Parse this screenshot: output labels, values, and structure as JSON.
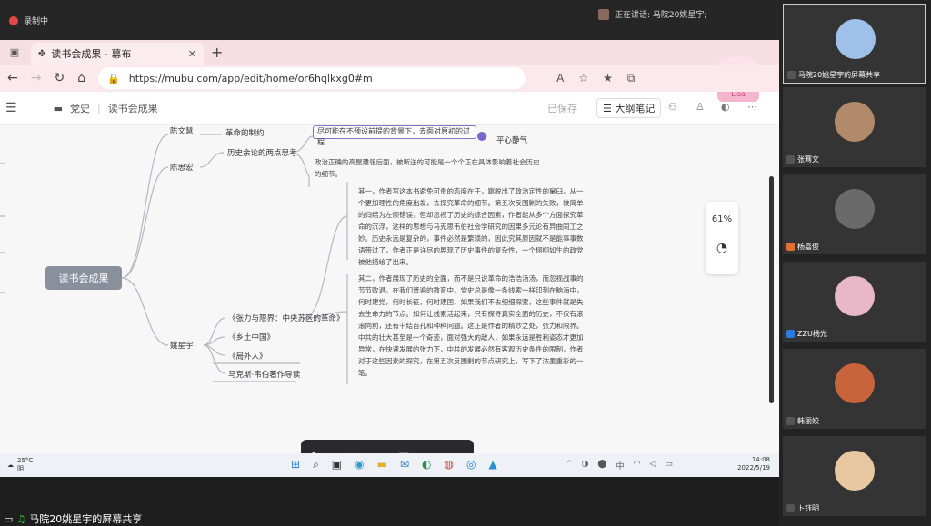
{
  "recording": {
    "label": "录制中"
  },
  "speaking": {
    "label": "正在讲话: 马院20姚星宇;"
  },
  "tab": {
    "title": "读书会成果 - 幕布"
  },
  "url": {
    "address": "https://mubu.com/app/edit/home/or6hqlkxg0#m"
  },
  "app": {
    "breadcrumb_root": "党史",
    "breadcrumb_doc": "读书会成果",
    "saved": "已保存",
    "outline_label": "大纲笔记"
  },
  "mindmap": {
    "center": "读书会成果",
    "n_chenwenhui": "陈文慧",
    "n_gemingzhidu": "革命的制约",
    "n_chensihong": "陈思宏",
    "n_lishiyulun": "历史余论的两点思考",
    "hl": "尽可能在不预设前提的背景下，去面对原初的过程",
    "n_pingxin": "平心静气",
    "n_zhengzhi": "政治正确的高屋建瓴后面，被断送的可能是一个个正在具体影响着社会历史的细节。",
    "para1": "其一，作者写这本书避免可贵的态度在于，跳脱出了政治定性的窠臼，从一个更加理性的角度出发，去探究革命的细节。第五次反围剿的失败，被简单的归结为左倾错误，但却忽视了历史的综合因素，作者能从多个方面探究革命的沉浮，这样的思想与马克思韦伯社会学研究的因果多元论有异曲同工之妙。历史永远是复杂的，事件必然是繁琐的，因此究其原因就不是能事事数语带过了，作者正是详尽的展现了历史事件的复杂性，一个栩栩如生的政党被他描绘了出来。",
    "para2": "其二，作者展现了历史的全面，而不是只说革命的浩浩汤汤，而忽视战事的节节败退。在我们普遍的教育中，党史总是像一条线索一样印刻在脑海中，何时建党，何时长征，何时建国，如果我们不去细细探索，这些事件就是失去生命力的节点。如何让线索活起来，只有探寻真实全面的历史，不仅有滚滚向前，还有千结百孔和种种问题。这正是作者的精妙之处，张力和限界。中共的壮大甚至是一个奇迹，面对强大的敌人，如果永远是胜利姿态才更加异常，在快速发展的张力下，中共的发展必然有客观历史条件的限制，作者对于这些因素的探究，在第五次反围剿的节点研究上，写下了浓墨重彩的一笔。",
    "n_yaoxingyu": "姚星宇",
    "b1": "《张力与限界：中央苏区的革命》",
    "b2": "《乡土中国》",
    "b3": "《局外人》",
    "b4": "马克斯·韦伯著作导读"
  },
  "zoom": {
    "value": "61%"
  },
  "taskbar": {
    "temp": "25°C",
    "weather": "阴",
    "time": "14:08",
    "date": "2022/5/19"
  },
  "share_label": "马院20姚星宇的屏幕共享",
  "participants": [
    {
      "name": "马院20姚星宇的屏幕共享",
      "color": "#9fc0e8"
    },
    {
      "name": "张骞文",
      "color": "#b08a6a"
    },
    {
      "name": "杨嘉俊",
      "color": "#6a6a6a"
    },
    {
      "name": "ZZU杨光",
      "color": "#e8b8c8"
    },
    {
      "name": "韩丽姣",
      "color": "#c8643c"
    },
    {
      "name": "卜钰明",
      "color": "#e8c8a0"
    }
  ]
}
